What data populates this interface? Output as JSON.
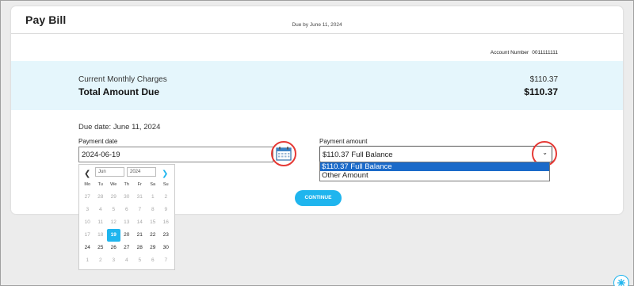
{
  "header": {
    "title": "Pay Bill",
    "due_by": "Due by June 11, 2024"
  },
  "account": {
    "label": "Account Number",
    "number": "0011111111"
  },
  "summary": {
    "current_label": "Current Monthly Charges",
    "current_value": "$110.37",
    "total_label": "Total Amount Due",
    "total_value": "$110.37"
  },
  "form": {
    "due_date_text": "Due date: June 11, 2024",
    "payment_date_label": "Payment date",
    "payment_date_value": "2024-06-19",
    "calendar_icon": "calendar-icon",
    "payment_amount_label": "Payment amount",
    "payment_amount_value": "$110.37 Full Balance",
    "options": [
      "$110.37 Full Balance",
      "Other Amount"
    ],
    "selected_option_index": 0,
    "continue_label": "CONTINUE"
  },
  "datepicker": {
    "month": "Jun",
    "year": "2024",
    "prev_icon": "chevron-left-icon",
    "next_icon": "chevron-right-icon",
    "days_of_week": [
      "Mo",
      "Tu",
      "We",
      "Th",
      "Fr",
      "Sa",
      "Su"
    ],
    "weeks": [
      [
        {
          "d": "27",
          "disabled": true
        },
        {
          "d": "28",
          "disabled": true
        },
        {
          "d": "29",
          "disabled": true
        },
        {
          "d": "30",
          "disabled": true
        },
        {
          "d": "31",
          "disabled": true
        },
        {
          "d": "1",
          "disabled": true
        },
        {
          "d": "2",
          "disabled": true
        }
      ],
      [
        {
          "d": "3",
          "disabled": true
        },
        {
          "d": "4",
          "disabled": true
        },
        {
          "d": "5",
          "disabled": true
        },
        {
          "d": "6",
          "disabled": true
        },
        {
          "d": "7",
          "disabled": true
        },
        {
          "d": "8",
          "disabled": true
        },
        {
          "d": "9",
          "disabled": true
        }
      ],
      [
        {
          "d": "10",
          "disabled": true
        },
        {
          "d": "11",
          "disabled": true
        },
        {
          "d": "12",
          "disabled": true
        },
        {
          "d": "13",
          "disabled": true
        },
        {
          "d": "14",
          "disabled": true
        },
        {
          "d": "15",
          "disabled": true
        },
        {
          "d": "16",
          "disabled": true
        }
      ],
      [
        {
          "d": "17",
          "disabled": true
        },
        {
          "d": "18",
          "disabled": true
        },
        {
          "d": "19",
          "selected": true
        },
        {
          "d": "20"
        },
        {
          "d": "21"
        },
        {
          "d": "22"
        },
        {
          "d": "23"
        }
      ],
      [
        {
          "d": "24"
        },
        {
          "d": "25"
        },
        {
          "d": "26"
        },
        {
          "d": "27"
        },
        {
          "d": "28"
        },
        {
          "d": "29"
        },
        {
          "d": "30"
        }
      ],
      [
        {
          "d": "1",
          "disabled": true
        },
        {
          "d": "2",
          "disabled": true
        },
        {
          "d": "3",
          "disabled": true
        },
        {
          "d": "4",
          "disabled": true
        },
        {
          "d": "5",
          "disabled": true
        },
        {
          "d": "6",
          "disabled": true
        },
        {
          "d": "7",
          "disabled": true
        }
      ]
    ]
  },
  "colors": {
    "accent": "#1fb5ee",
    "band": "#e5f6fc",
    "highlight_circle": "#e53935",
    "option_selected": "#1b6ac9"
  }
}
